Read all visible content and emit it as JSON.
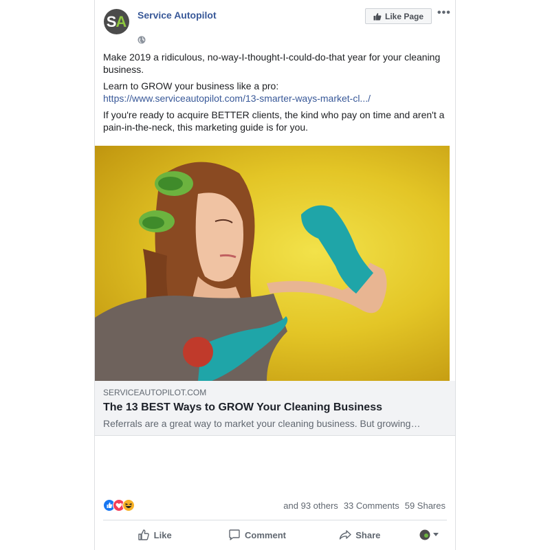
{
  "post": {
    "page_name": "Service Autopilot",
    "avatar_letters": {
      "first": "S",
      "second": "A"
    },
    "like_page_label": "Like Page",
    "more_label": "•••",
    "paragraphs": {
      "p1": "Make 2019 a ridiculous, no-way-I-thought-I-could-do-that year for your cleaning business.",
      "p2_text": "Learn to GROW your business like a pro:",
      "p2_link": "https://www.serviceautopilot.com/13-smarter-ways-market-cl.../",
      "p3": "If you're ready to acquire BETTER clients, the kind who pay on time and aren't a pain-in-the-neck, this marketing guide is for you."
    }
  },
  "link_preview": {
    "domain": "SERVICEAUTOPILOT.COM",
    "headline": "The 13 BEST Ways to GROW Your Cleaning Business",
    "description": "Referrals are a great way to market your cleaning business. But growing…"
  },
  "stats": {
    "others": "and 93 others",
    "comments": "33 Comments",
    "shares": "59 Shares"
  },
  "actions": {
    "like": "Like",
    "comment": "Comment",
    "share": "Share"
  },
  "colors": {
    "link_blue": "#385898",
    "like_blue": "#1877f2",
    "love_red": "#f33e58",
    "haha_yellow": "#f7b125",
    "photo_yellow": "#e3c526",
    "glove_teal": "#1fa5a8"
  }
}
